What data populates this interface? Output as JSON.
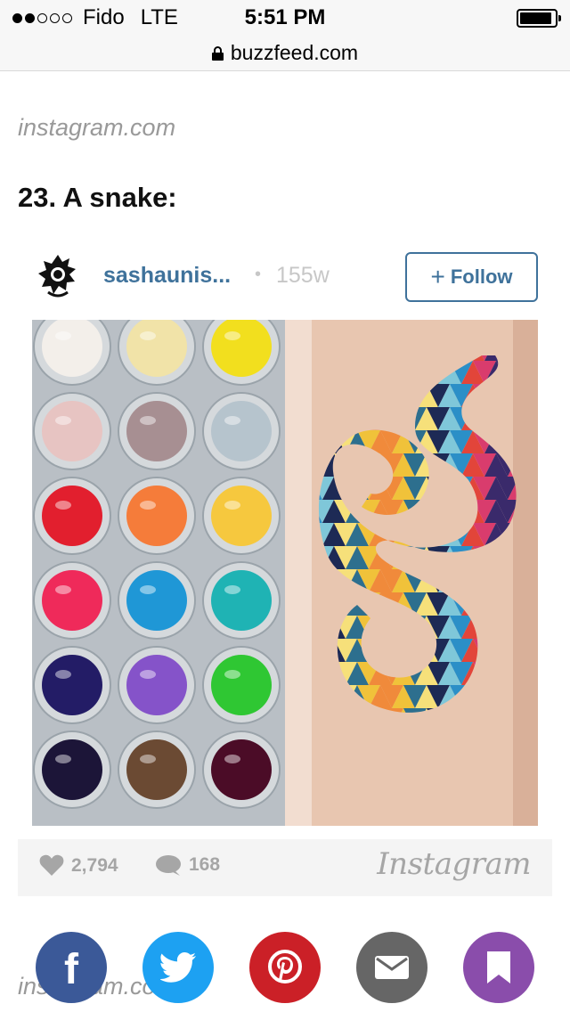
{
  "status_bar": {
    "carrier": "Fido",
    "network": "LTE",
    "time": "5:51 PM",
    "signal_bars": 2,
    "signal_total": 5,
    "battery_level": 0.92
  },
  "browser": {
    "url": "buzzfeed.com",
    "lock_icon": "lock-icon"
  },
  "article": {
    "source_top": "instagram.com",
    "heading": "23. A snake:",
    "source_bottom": "instagram.com"
  },
  "embed": {
    "username": "sashaunis...",
    "separator": "•",
    "age": "155w",
    "follow_label": "Follow",
    "follow_plus": "+",
    "likes": "2,794",
    "comments": "168",
    "brand": "Instagram",
    "photo_alt": "Paint pots next to a geometric snake tattoo"
  },
  "share": {
    "facebook_glyph": "f",
    "colors": {
      "facebook": "#3b5998",
      "twitter": "#1da1f2",
      "pinterest": "#cb2027",
      "email": "#666666",
      "bookmark": "#8a4dab"
    }
  },
  "colors": {
    "instagram_blue": "#3f729b",
    "muted_gray": "#a6a6a6",
    "source_gray": "#999999"
  }
}
